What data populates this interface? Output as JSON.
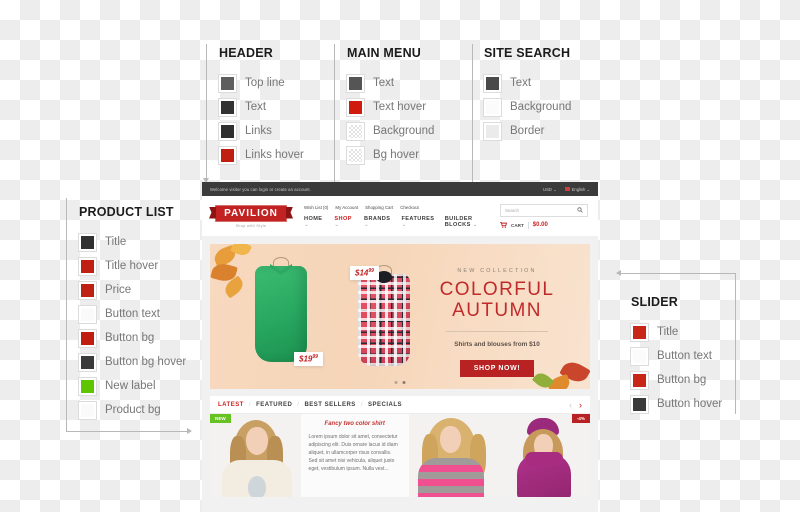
{
  "legends": [
    {
      "id": "header",
      "title": "HEADER",
      "items": [
        {
          "label": "Top line",
          "color": "#5e5e5e",
          "type": "solid"
        },
        {
          "label": "Text",
          "color": "#333333",
          "type": "solid"
        },
        {
          "label": "Links",
          "color": "#2e2e2e",
          "type": "solid"
        },
        {
          "label": "Links hover",
          "color": "#c01e10",
          "type": "solid"
        }
      ]
    },
    {
      "id": "main-menu",
      "title": "MAIN MENU",
      "items": [
        {
          "label": "Text",
          "color": "#555555",
          "type": "solid"
        },
        {
          "label": "Text hover",
          "color": "#d01a0e",
          "type": "solid"
        },
        {
          "label": "Background",
          "color": "",
          "type": "transparent"
        },
        {
          "label": "Bg hover",
          "color": "",
          "type": "transparent"
        }
      ]
    },
    {
      "id": "site-search",
      "title": "SITE SEARCH",
      "items": [
        {
          "label": "Text",
          "color": "#4a4a4a",
          "type": "solid"
        },
        {
          "label": "Background",
          "color": "#fbfbfb",
          "type": "solid"
        },
        {
          "label": "Border",
          "color": "#ebebeb",
          "type": "solid"
        }
      ]
    },
    {
      "id": "product-list",
      "title": "PRODUCT LIST",
      "items": [
        {
          "label": "Button text",
          "color": "#fafafa",
          "type": "solid"
        },
        {
          "label": "Title",
          "color": "#303030",
          "type": "solid"
        },
        {
          "label": "Title hover",
          "color": "#c02014",
          "type": "solid"
        },
        {
          "label": "Price",
          "color": "#bf2014",
          "type": "solid"
        },
        {
          "label": "Button bg",
          "color": "#c01e10",
          "type": "solid"
        },
        {
          "label": "Button bg hover",
          "color": "#3a3a3a",
          "type": "solid"
        },
        {
          "label": "New label",
          "color": "#5ec500",
          "type": "solid"
        },
        {
          "label": "Product bg",
          "color": "#fafafa",
          "type": "solid"
        }
      ],
      "order": [
        "Title",
        "Title hover",
        "Price",
        "Button text",
        "Button bg",
        "Button bg hover",
        "New label",
        "Product bg"
      ]
    },
    {
      "id": "slider",
      "title": "SLIDER",
      "items": [
        {
          "label": "Title",
          "color": "#c9261a",
          "type": "solid"
        },
        {
          "label": "Button text",
          "color": "#fbfbfb",
          "type": "solid"
        },
        {
          "label": "Button bg",
          "color": "#c9261a",
          "type": "solid"
        },
        {
          "label": "Button hover",
          "color": "#3a3a3a",
          "type": "solid"
        }
      ]
    }
  ],
  "mockup": {
    "topbar": {
      "welcome": "Welcome visitor you can login or create an account.",
      "currency": "USD",
      "currency_caret": "⌄",
      "language": "English",
      "language_caret": "⌄"
    },
    "logo": {
      "name": "PAVILION",
      "tagline": "Shop with Style"
    },
    "top_links": [
      "Wish List (0)",
      "My Account",
      "Shopping Cart",
      "Checkout"
    ],
    "main_menu": [
      {
        "label": "HOME",
        "active": false,
        "caret": "⌄"
      },
      {
        "label": "SHOP",
        "active": true,
        "caret": "⌄"
      },
      {
        "label": "BRANDS",
        "active": false,
        "caret": "⌄"
      },
      {
        "label": "FEATURES",
        "active": false,
        "caret": "⌄"
      },
      {
        "label": "BUILDER BLOCKS",
        "active": false,
        "caret": "⌄"
      }
    ],
    "search": {
      "placeholder": "Search",
      "icon": "search-icon"
    },
    "cart": {
      "label": "CART",
      "amount": "$0.00",
      "icon": "cart-icon"
    },
    "banner": {
      "eyebrow": "NEW COLLECTION",
      "title_line1": "COLORFUL",
      "title_line2": "AUTUMN",
      "subtitle": "Shirts and blouses from $10",
      "button": "SHOP NOW!",
      "price_tag_left": "$19",
      "price_tag_left_sup": "99",
      "price_tag_right": "$14",
      "price_tag_right_sup": "99",
      "dots": 2,
      "active_dot": 2
    },
    "tabs": [
      {
        "label": "LATEST",
        "active": true
      },
      {
        "label": "FEATURED",
        "active": false
      },
      {
        "label": "BEST SELLERS",
        "active": false
      },
      {
        "label": "SPECIALS",
        "active": false
      }
    ],
    "tab_separator": "/",
    "tab_nav": {
      "prev": "‹",
      "next": "›"
    },
    "products": [
      {
        "badge": "NEW",
        "badge_type": "new"
      },
      {
        "badge": "",
        "badge_type": ""
      },
      {
        "badge": "-4%",
        "badge_type": "sale"
      }
    ],
    "product_detail": {
      "title": "Fancy two color shirt",
      "description": "Lorem ipsum dolor sit amet, consectetur adipiscing elit. Duis ornare lacus id diam aliquet, in ullamcorper risus convallis. Sed sit amet nisi vehicula, aliquet justo eget, vestibulum ipsum. Nulla vest..."
    }
  }
}
